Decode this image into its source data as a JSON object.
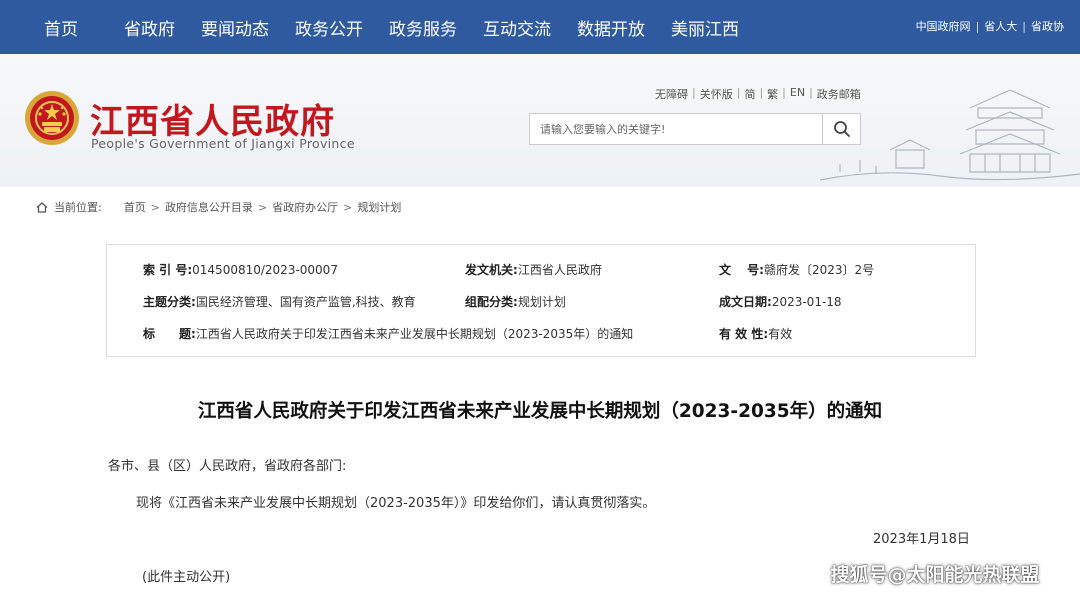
{
  "topnav": {
    "items": [
      "首页",
      "省政府",
      "要闻动态",
      "政务公开",
      "政务服务",
      "互动交流",
      "数据开放",
      "美丽江西"
    ],
    "links": [
      "中国政府网",
      "省人大",
      "省政协"
    ]
  },
  "header": {
    "title": "江西省人民政府",
    "subtitle": "People's Government of Jiangxi Province",
    "util_links": [
      "无障碍",
      "关怀版",
      "简",
      "繁",
      "EN",
      "政务邮箱"
    ],
    "search_placeholder": "请输入您要输入的关键字!"
  },
  "breadcrumb": {
    "label": "当前位置:",
    "items": [
      "首页",
      "政府信息公开目录",
      "省政府办公厅",
      "规划计划"
    ]
  },
  "meta": {
    "index_label": "索 引 号:",
    "index_value": "014500810/2023-00007",
    "issuer_label": "发文机关:",
    "issuer_value": "江西省人民政府",
    "docno_label": "文　 号:",
    "docno_value": "赣府发〔2023〕2号",
    "topic_label": "主题分类:",
    "topic_value": "国民经济管理、国有资产监管,科技、教育",
    "category_label": "组配分类:",
    "category_value": "规划计划",
    "date_label": "成文日期:",
    "date_value": "2023-01-18",
    "title_label": "标　　题:",
    "title_value": "江西省人民政府关于印发江西省未来产业发展中长期规划（2023-2035年）的通知",
    "validity_label": "有 效 性:",
    "validity_value": "有效"
  },
  "document": {
    "title": "江西省人民政府关于印发江西省未来产业发展中长期规划（2023-2035年）的通知",
    "salutation": "各市、县（区）人民政府，省政府各部门:",
    "body": "现将《江西省未来产业发展中长期规划（2023-2035年）》印发给你们，请认真贯彻落实。",
    "date": "2023年1月18日",
    "note": "(此件主动公开)"
  },
  "watermark": "搜狐号@太阳能光热联盟",
  "colors": {
    "nav_bg": "#2f5aa0",
    "title_red": "#c3171e"
  }
}
